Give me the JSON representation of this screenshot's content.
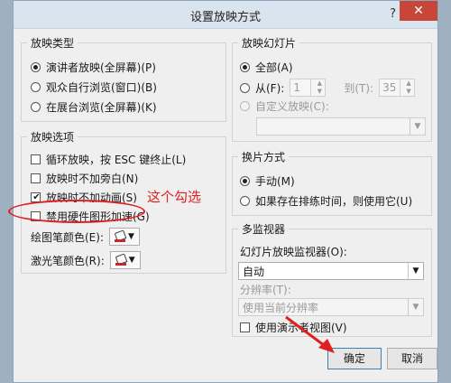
{
  "dialog": {
    "title": "设置放映方式",
    "help": "?",
    "close": "✕"
  },
  "show_type": {
    "title": "放映类型",
    "options": [
      "演讲者放映(全屏幕)(P)",
      "观众自行浏览(窗口)(B)",
      "在展台浏览(全屏幕)(K)"
    ],
    "selected": 0
  },
  "show_options": {
    "title": "放映选项",
    "checks": [
      {
        "label": "循环放映，按 ESC 键终止(L)",
        "checked": false
      },
      {
        "label": "放映时不加旁白(N)",
        "checked": false
      },
      {
        "label": "放映时不加动画(S)",
        "checked": true
      },
      {
        "label": "禁用硬件图形加速(G)",
        "checked": false
      }
    ],
    "pen_color_label": "绘图笔颜色(E):",
    "laser_color_label": "激光笔颜色(R):"
  },
  "slides": {
    "title": "放映幻灯片",
    "all_label": "全部(A)",
    "from_label": "从(F):",
    "from_value": "1",
    "to_label": "到(T):",
    "to_value": "35",
    "custom_label": "自定义放映(C):",
    "custom_value": ""
  },
  "advance": {
    "title": "换片方式",
    "manual_label": "手动(M)",
    "timed_label": "如果存在排练时间，则使用它(U)"
  },
  "monitors": {
    "title": "多监视器",
    "monitor_label": "幻灯片放映监视器(O):",
    "monitor_value": "自动",
    "resolution_label": "分辨率(T):",
    "resolution_value": "使用当前分辨率",
    "presenter_view_label": "使用演示者视图(V)"
  },
  "buttons": {
    "ok": "确定",
    "cancel": "取消"
  },
  "annotation": {
    "text": "这个勾选"
  },
  "colors": {
    "accent": "#3c7fb1",
    "annotation": "#e02020",
    "close": "#c8453a"
  }
}
